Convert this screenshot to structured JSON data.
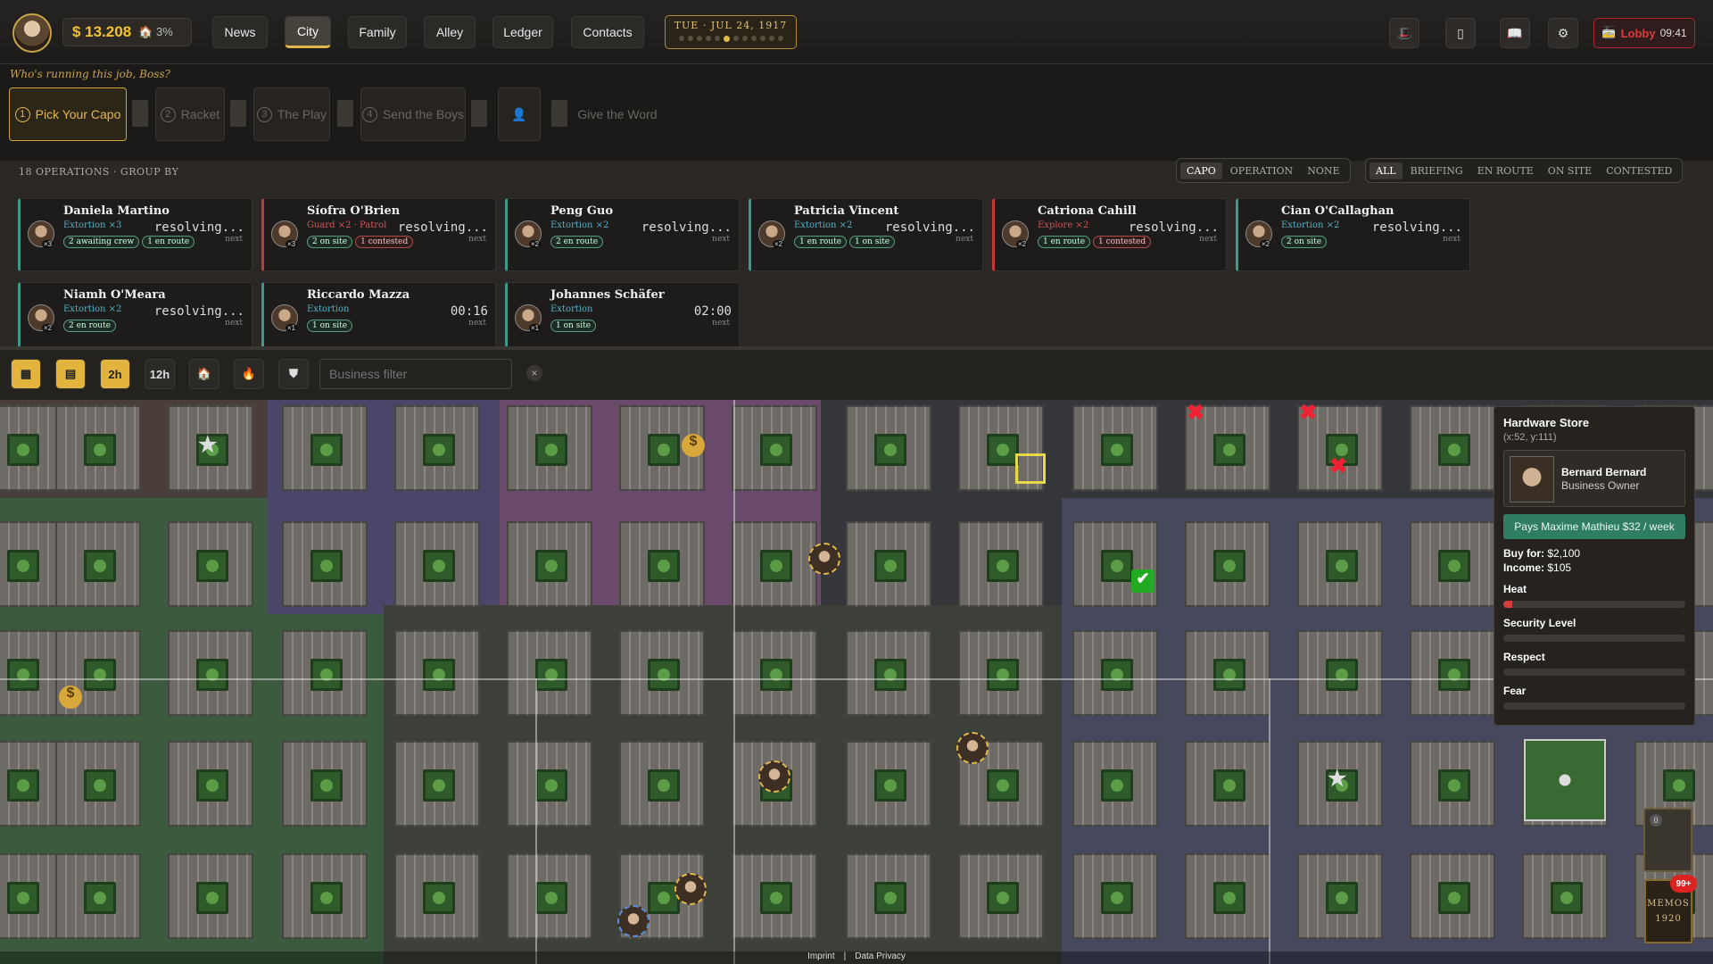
{
  "topbar": {
    "money": "$ 13.208",
    "heat_pct": "3%",
    "nav": [
      "News",
      "City",
      "Family",
      "Alley",
      "Ledger",
      "Contacts"
    ],
    "active_nav": "City",
    "date": "TUE · JUL 24, 1917",
    "lobby_label": "Lobby",
    "lobby_time": "09:41"
  },
  "steps": {
    "hint": "Who's running this job, Boss?",
    "items": [
      {
        "num": "1",
        "label": "Pick Your Capo"
      },
      {
        "num": "2",
        "label": "Racket"
      },
      {
        "num": "3",
        "label": "The Play"
      },
      {
        "num": "4",
        "label": "Send the Boys"
      },
      {
        "num": "",
        "label": "Give the Word"
      }
    ]
  },
  "operations": {
    "count_label": "18 OPERATIONS · GROUP BY",
    "group_by": [
      "CAPO",
      "OPERATION",
      "NONE"
    ],
    "filters": [
      "ALL",
      "BRIEFING",
      "EN ROUTE",
      "ON SITE",
      "CONTESTED"
    ],
    "next": "next",
    "cards": [
      {
        "name": "Daniela Martino",
        "sub": "Extortion ×3",
        "status": "resolving...",
        "x": "×3",
        "tags": [
          "2 awaiting crew",
          "1 en route"
        ],
        "red": false
      },
      {
        "name": "Síofra O'Brien",
        "sub": "Guard ×2 · Patrol",
        "status": "resolving...",
        "x": "×3",
        "tags": [
          "2 on site",
          "1 contested"
        ],
        "red": true
      },
      {
        "name": "Peng Guo",
        "sub": "Extortion ×2",
        "status": "resolving...",
        "x": "×2",
        "tags": [
          "2 en route"
        ],
        "red": false
      },
      {
        "name": "Patricia Vincent",
        "sub": "Extortion ×2",
        "status": "resolving...",
        "x": "×2",
        "tags": [
          "1 en route",
          "1 on site"
        ],
        "red": false
      },
      {
        "name": "Catriona Cahill",
        "sub": "Explore ×2",
        "status": "resolving...",
        "x": "×2",
        "tags": [
          "1 en route",
          "1 contested"
        ],
        "red": true
      },
      {
        "name": "Cian O'Callaghan",
        "sub": "Extortion ×2",
        "status": "resolving...",
        "x": "×2",
        "tags": [
          "2 on site"
        ],
        "red": false
      },
      {
        "name": "Niamh O'Meara",
        "sub": "Extortion ×2",
        "status": "resolving...",
        "x": "×2",
        "tags": [
          "2 en route"
        ],
        "red": false
      },
      {
        "name": "Riccardo Mazza",
        "sub": "Extortion",
        "status": "00:16",
        "x": "×1",
        "tags": [
          "1 on site"
        ],
        "red": false
      },
      {
        "name": "Johannes Schäfer",
        "sub": "Extortion",
        "status": "02:00",
        "x": "×1",
        "tags": [
          "1 on site"
        ],
        "red": false
      }
    ]
  },
  "maptools": {
    "time_2h": "2h",
    "time_12h": "12h",
    "filter_placeholder": "Business filter",
    "clear": "×"
  },
  "business_panel": {
    "title": "Hardware Store",
    "coords": "(x:52, y:111)",
    "owner_name": "Bernard Bernard",
    "owner_role": "Business Owner",
    "pays": "Pays Maxime Mathieu $32 / week",
    "buy_label": "Buy for:",
    "buy_value": "$2,100",
    "income_label": "Income:",
    "income_value": "$105",
    "stats": [
      {
        "label": "Heat",
        "value": 0.05
      },
      {
        "label": "Security Level",
        "value": 0
      },
      {
        "label": "Respect",
        "value": 0
      },
      {
        "label": "Fear",
        "value": 0
      }
    ]
  },
  "memos": {
    "label": "MEMOS",
    "year": "1920",
    "badge": "99+",
    "slot_count": "0"
  },
  "footer": {
    "imprint": "Imprint",
    "sep": "|",
    "privacy": "Data Privacy"
  },
  "colors": {
    "accent": "#e3b84a",
    "money": "#f2c232",
    "alert": "#d63a3a",
    "teal": "#3a9b8c"
  }
}
